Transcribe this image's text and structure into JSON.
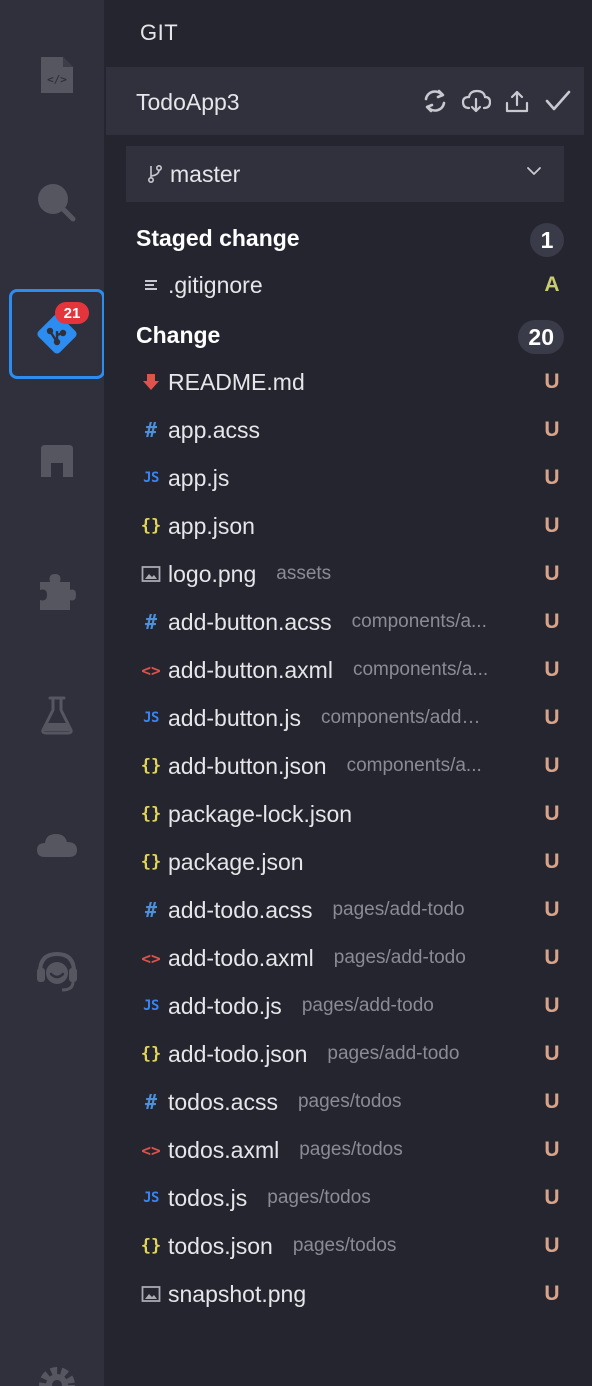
{
  "activity_bar": {
    "items": [
      {
        "name": "explorer-icon"
      },
      {
        "name": "search-icon"
      },
      {
        "name": "git-icon",
        "badge": "21",
        "active": true
      },
      {
        "name": "components-icon"
      },
      {
        "name": "extensions-icon"
      },
      {
        "name": "test-icon"
      },
      {
        "name": "cloud-icon"
      },
      {
        "name": "support-icon"
      },
      {
        "name": "settings-icon"
      }
    ]
  },
  "panel": {
    "title": "GIT",
    "repo": {
      "name": "TodoApp3",
      "actions": [
        "refresh-icon",
        "pull-icon",
        "push-icon",
        "commit-icon"
      ]
    },
    "branch": {
      "name": "master"
    },
    "staged": {
      "label": "Staged change",
      "count": "1",
      "files": [
        {
          "name": ".gitignore",
          "path": "",
          "status": "A",
          "icon": "text-file-icon"
        }
      ]
    },
    "changes": {
      "label": "Change",
      "count": "20",
      "files": [
        {
          "name": "README.md",
          "path": "",
          "status": "U",
          "icon": "markdown-icon"
        },
        {
          "name": "app.acss",
          "path": "",
          "status": "U",
          "icon": "css-icon"
        },
        {
          "name": "app.js",
          "path": "",
          "status": "U",
          "icon": "js-icon"
        },
        {
          "name": "app.json",
          "path": "",
          "status": "U",
          "icon": "json-icon"
        },
        {
          "name": "logo.png",
          "path": "assets",
          "status": "U",
          "icon": "image-icon"
        },
        {
          "name": "add-button.acss",
          "path": "components/a...",
          "status": "U",
          "icon": "css-icon"
        },
        {
          "name": "add-button.axml",
          "path": "components/a...",
          "status": "U",
          "icon": "xml-icon"
        },
        {
          "name": "add-button.js",
          "path": "components/add-...",
          "status": "U",
          "icon": "js-icon"
        },
        {
          "name": "add-button.json",
          "path": "components/a...",
          "status": "U",
          "icon": "json-icon"
        },
        {
          "name": "package-lock.json",
          "path": "",
          "status": "U",
          "icon": "json-icon"
        },
        {
          "name": "package.json",
          "path": "",
          "status": "U",
          "icon": "json-icon"
        },
        {
          "name": "add-todo.acss",
          "path": "pages/add-todo",
          "status": "U",
          "icon": "css-icon"
        },
        {
          "name": "add-todo.axml",
          "path": "pages/add-todo",
          "status": "U",
          "icon": "xml-icon"
        },
        {
          "name": "add-todo.js",
          "path": "pages/add-todo",
          "status": "U",
          "icon": "js-icon"
        },
        {
          "name": "add-todo.json",
          "path": "pages/add-todo",
          "status": "U",
          "icon": "json-icon"
        },
        {
          "name": "todos.acss",
          "path": "pages/todos",
          "status": "U",
          "icon": "css-icon"
        },
        {
          "name": "todos.axml",
          "path": "pages/todos",
          "status": "U",
          "icon": "xml-icon"
        },
        {
          "name": "todos.js",
          "path": "pages/todos",
          "status": "U",
          "icon": "js-icon"
        },
        {
          "name": "todos.json",
          "path": "pages/todos",
          "status": "U",
          "icon": "json-icon"
        },
        {
          "name": "snapshot.png",
          "path": "",
          "status": "U",
          "icon": "image-icon"
        }
      ]
    }
  },
  "colors": {
    "accent": "#2d8cf0",
    "badge": "#e5353c",
    "untracked": "#d9a38a",
    "added": "#c8cc6f"
  }
}
